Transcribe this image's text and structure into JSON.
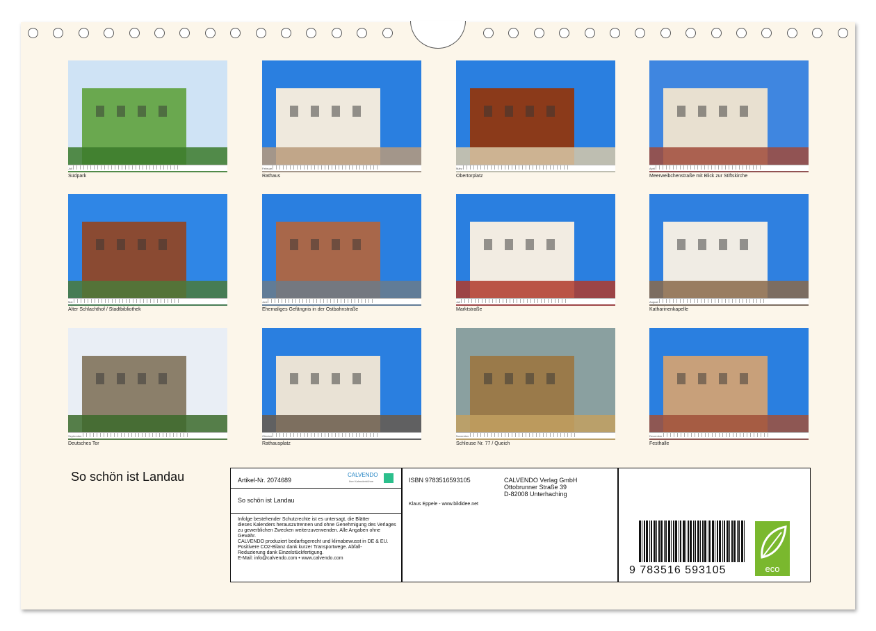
{
  "calendar_title": "So schön ist Landau",
  "photos": [
    {
      "caption": "Südpark",
      "month": "Juli"
    },
    {
      "caption": "Rathaus",
      "month": "Februar"
    },
    {
      "caption": "Obertorplatz",
      "month": "März"
    },
    {
      "caption": "Meerweibchenstraße mit Blick zur Stiftskirche",
      "month": "April"
    },
    {
      "caption": "Alter Schlachthof / Stadtbibliothek",
      "month": "Mai"
    },
    {
      "caption": "Ehemaliges Gefängnis in der Ostbahnstraße",
      "month": "Juni"
    },
    {
      "caption": "Marktstraße",
      "month": "Juli"
    },
    {
      "caption": "Katharinenkapelle",
      "month": "August"
    },
    {
      "caption": "Deutsches Tor",
      "month": "September"
    },
    {
      "caption": "Rathausplatz",
      "month": "Oktober"
    },
    {
      "caption": "Schleuse Nr. 77 / Queich",
      "month": "November"
    },
    {
      "caption": "Festhalle",
      "month": "Dezember"
    }
  ],
  "info": {
    "article_nr": "Artikel-Nr. 2074689",
    "product_title": "So schön ist Landau",
    "isbn": "ISBN 9783516593105",
    "publisher_name": "CALVENDO Verlag GmbH",
    "publisher_street": "Ottobrunner Straße 39",
    "publisher_city": "D-82008 Unterhaching",
    "author": "Klaus Eppele - www.bildidee.net",
    "legal_1": "Infolge bestehender Schutzrechte ist es untersagt, die Blätter",
    "legal_2": "dieses Kalenders herauszutrennen und ohne Genehmigung des Verlages",
    "legal_3": "zu gewerblichen Zwecken weiterzuverwenden. Alle Angaben ohne",
    "legal_4": "Gewähr.",
    "legal_5": "CALVENDO produziert bedarfsgerecht und klimabewusst in DE & EU.",
    "legal_6": "Positivere CO2-Bilanz dank kurzer Transportwege. Abfall-",
    "legal_7": "Reduzierung dank Einzelstückfertigung.",
    "legal_8": "E-Mail: info@calvendo.com • www.calvendo.com",
    "ean": "9 783516 593105",
    "logo_text": "CALVENDO",
    "logo_sub": "Ihre Kalenderbühne",
    "eco_label": "eco"
  },
  "colors": {
    "page_bg": "#fcf6ea",
    "eco_green": "#7ab82e",
    "calvendo_blue": "#1a7fc1",
    "sky": "#2a7fe0"
  }
}
